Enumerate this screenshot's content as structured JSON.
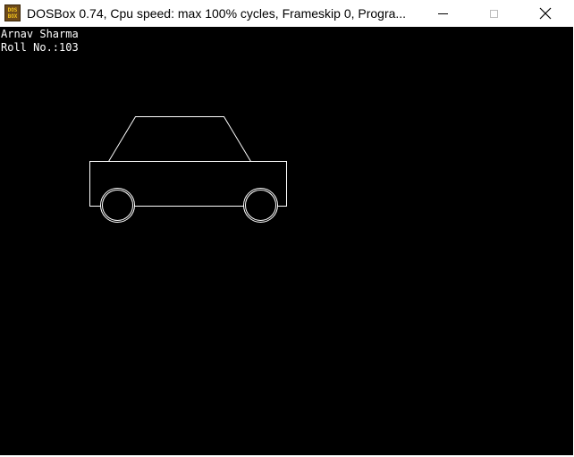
{
  "window": {
    "title": "DOSBox 0.74, Cpu speed: max 100% cycles, Frameskip  0, Progra...",
    "icon": "dosbox-app-icon",
    "icon_label_lines": [
      "DOS",
      "BOX"
    ],
    "controls": [
      "minimize-icon",
      "maximize-icon",
      "close-icon"
    ]
  },
  "screen": {
    "background": "#000000",
    "foreground": "#ffffff",
    "lines": {
      "name": "Arnav Sharma",
      "roll": "Roll No.:103"
    },
    "drawing": "car outline"
  }
}
